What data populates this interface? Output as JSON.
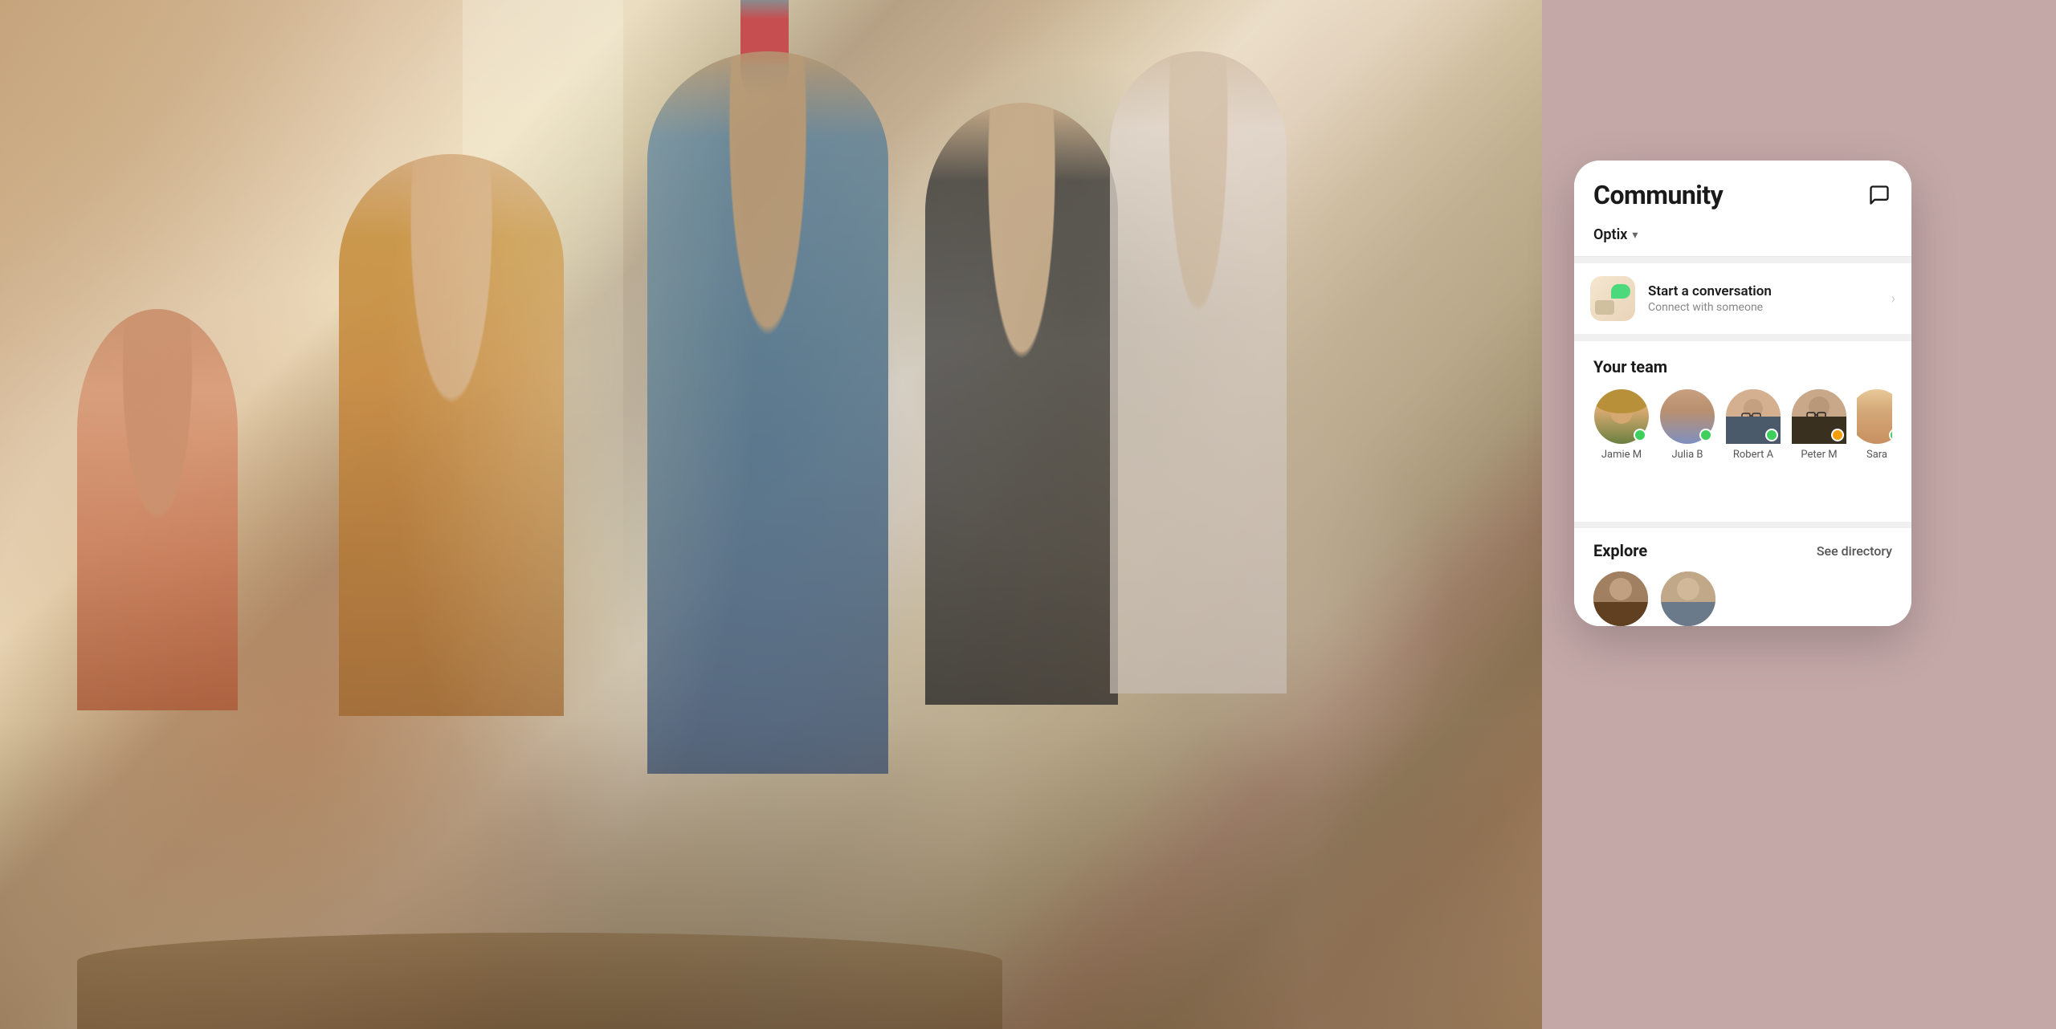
{
  "app": {
    "title": "Community",
    "chat_icon_label": "chat"
  },
  "workspace": {
    "name": "Optix",
    "chevron": "▾"
  },
  "start_conversation": {
    "title": "Start a conversation",
    "subtitle": "Connect with someone",
    "chevron": "›"
  },
  "team": {
    "section_title": "Your team",
    "members": [
      {
        "name": "Jamie M",
        "status": "green"
      },
      {
        "name": "Julia B",
        "status": "green"
      },
      {
        "name": "Robert A",
        "status": "green"
      },
      {
        "name": "Peter M",
        "status": "orange"
      },
      {
        "name": "Sara",
        "status": "green"
      }
    ]
  },
  "explore": {
    "section_title": "Explore",
    "see_directory_label": "See directory"
  },
  "colors": {
    "status_green": "#3ecf5c",
    "status_orange": "#f59e0b",
    "accent": "#4cd97b",
    "panel_bg": "#f5f5f5",
    "right_bg": "#c4a8a8"
  }
}
